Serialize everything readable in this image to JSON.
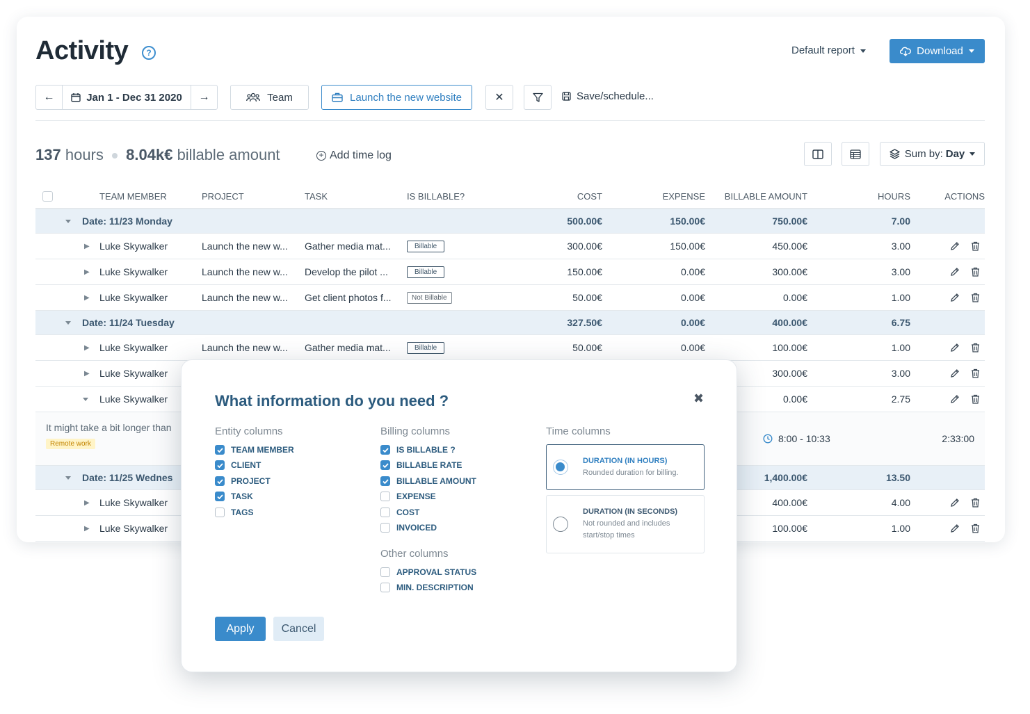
{
  "header": {
    "title": "Activity",
    "help_icon": "?",
    "default_report": "Default report",
    "download_label": "Download"
  },
  "toolbar": {
    "date_range": "Jan 1 - Dec 31 2020",
    "team_label": "Team",
    "project_label": "Launch the new website",
    "save_schedule": "Save/schedule..."
  },
  "summary": {
    "hours_value": "137",
    "hours_unit": "hours",
    "billable_value": "8.04k€",
    "billable_unit": "billable amount",
    "add_time_log": "Add time log",
    "sum_by_label": "Sum by:",
    "sum_by_value": "Day"
  },
  "table": {
    "headers": [
      "TEAM MEMBER",
      "PROJECT",
      "TASK",
      "IS BILLABLE?",
      "COST",
      "EXPENSE",
      "BILLABLE AMOUNT",
      "HOURS",
      "ACTIONS"
    ],
    "groups": [
      {
        "label": "Date: 11/23 Monday",
        "cost": "500.00€",
        "expense": "150.00€",
        "billable": "750.00€",
        "hours": "7.00"
      },
      {
        "label": "Date: 11/24 Tuesday",
        "cost": "327.50€",
        "expense": "0.00€",
        "billable": "400.00€",
        "hours": "6.75"
      },
      {
        "label": "Date: 11/25 Wednes",
        "billable": "1,400.00€",
        "hours": "13.50"
      }
    ],
    "rows": [
      {
        "member": "Luke Skywalker",
        "project": "Launch the new w...",
        "task": "Gather media mat...",
        "billable": "Billable",
        "cost": "300.00€",
        "expense": "150.00€",
        "amount": "450.00€",
        "hours": "3.00"
      },
      {
        "member": "Luke Skywalker",
        "project": "Launch the new w...",
        "task": "Develop the pilot ...",
        "billable": "Billable",
        "cost": "150.00€",
        "expense": "0.00€",
        "amount": "300.00€",
        "hours": "3.00"
      },
      {
        "member": "Luke Skywalker",
        "project": "Launch the new w...",
        "task": "Get client photos f...",
        "billable": "Not Billable",
        "cost": "50.00€",
        "expense": "0.00€",
        "amount": "0.00€",
        "hours": "1.00"
      },
      {
        "member": "Luke Skywalker",
        "project": "Launch the new w...",
        "task": "Gather media mat...",
        "billable": "Billable",
        "cost": "50.00€",
        "expense": "0.00€",
        "amount": "100.00€",
        "hours": "1.00"
      },
      {
        "member": "Luke Skywalker",
        "amount": "300.00€",
        "hours": "3.00"
      },
      {
        "member": "Luke Skywalker",
        "amount": "0.00€",
        "hours": "2.75"
      },
      {
        "member": "Luke Skywalker",
        "amount": "400.00€",
        "hours": "4.00"
      },
      {
        "member": "Luke Skywalker",
        "amount": "100.00€",
        "hours": "1.00"
      }
    ],
    "note": {
      "text": "It might take a bit longer than",
      "tag": "Remote work",
      "time_range": "8:00 - 10:33",
      "duration": "2:33:00"
    }
  },
  "modal": {
    "title": "What information do you need ?",
    "entity_title": "Entity columns",
    "entity": [
      {
        "label": "TEAM MEMBER",
        "checked": true
      },
      {
        "label": "CLIENT",
        "checked": true
      },
      {
        "label": "PROJECT",
        "checked": true
      },
      {
        "label": "TASK",
        "checked": true
      },
      {
        "label": "TAGS",
        "checked": false
      }
    ],
    "billing_title": "Billing columns",
    "billing": [
      {
        "label": "IS BILLABLE ?",
        "checked": true
      },
      {
        "label": "BILLABLE RATE",
        "checked": true
      },
      {
        "label": "BILLABLE AMOUNT",
        "checked": true
      },
      {
        "label": "EXPENSE",
        "checked": false
      },
      {
        "label": "COST",
        "checked": false
      },
      {
        "label": "INVOICED",
        "checked": false
      }
    ],
    "other_title": "Other columns",
    "other": [
      {
        "label": "APPROVAL STATUS",
        "checked": false
      },
      {
        "label": "MIN. DESCRIPTION",
        "checked": false
      }
    ],
    "time_title": "Time columns",
    "time_hours_title": "DURATION (IN HOURS)",
    "time_hours_desc": "Rounded duration for billing.",
    "time_seconds_title": "DURATION (IN SECONDS)",
    "time_seconds_desc": "Not rounded and includes start/stop times",
    "apply": "Apply",
    "cancel": "Cancel"
  },
  "colors": {
    "accent": "#3a8bcb",
    "group_bg": "#e8f0f7",
    "title_blue": "#2c5b7e"
  }
}
